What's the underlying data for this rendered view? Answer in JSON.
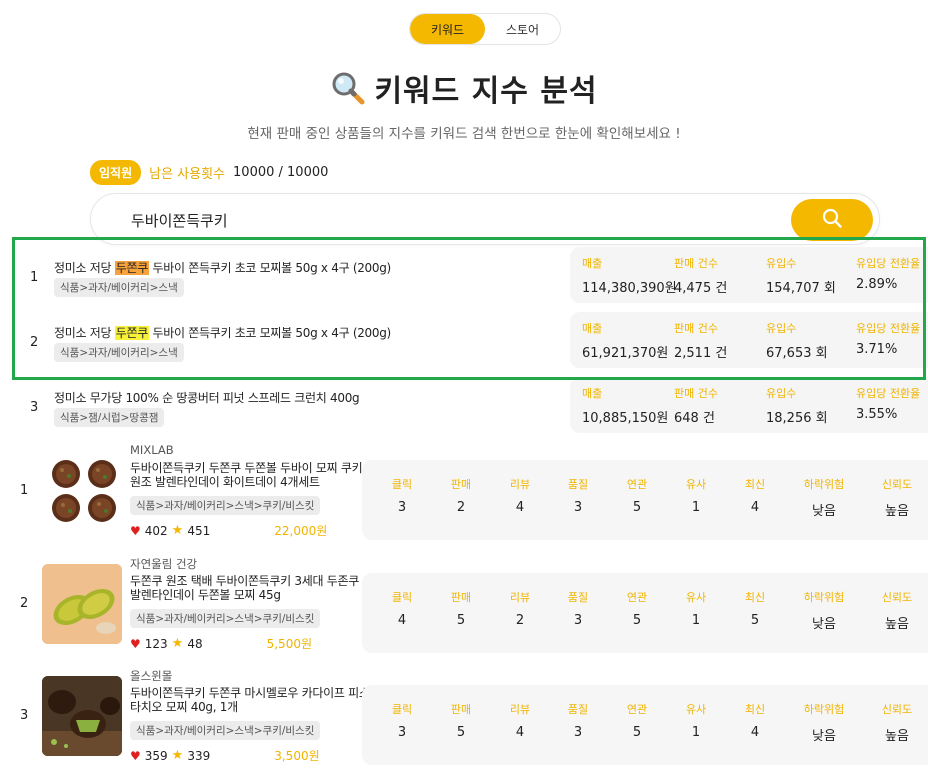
{
  "tabs": [
    {
      "label": "키워드",
      "active": true
    },
    {
      "label": "스토어",
      "active": false
    }
  ],
  "title": "키워드 지수 분석",
  "subtitle": "현재 판매 중인 상품들의 지수를 키워드 검색 한번으로 한눈에 확인해보세요 !",
  "usage": {
    "badge": "임직원",
    "label": "남은 사용횟수",
    "value": "10000 / 10000"
  },
  "search": {
    "value": "두바이쫀득쿠키"
  },
  "colors": {
    "accent": "#f5b800",
    "highlight_orange": "#f7a23a",
    "highlight_yellow": "#f7f13a",
    "selection_box": "#22a84a"
  },
  "keyword_labels": {
    "sales": "매출",
    "count": "판매 건수",
    "inflow": "유입수",
    "conv": "유입당 전환율"
  },
  "keyword_results": [
    {
      "rank": "1",
      "name_pre": "정미소 저당 ",
      "name_hl": "두쫀쿠",
      "name_post": " 두바이 쫀득쿠키 초코 모찌볼 50g x 4구 (200g)",
      "category": "식품>과자/베이커리>스낵",
      "sales": "114,380,390원",
      "count": "4,475 건",
      "inflow": "154,707 회",
      "conv": "2.89%"
    },
    {
      "rank": "2",
      "name_pre": "정미소 저당 ",
      "name_hl": "두쫀쿠",
      "name_post": " 두바이 쫀득쿠키 초코 모찌볼 50g x 4구 (200g)",
      "category": "식품>과자/베이커리>스낵",
      "sales": "61,921,370원",
      "count": "2,511 건",
      "inflow": "67,653 회",
      "conv": "3.71%"
    },
    {
      "rank": "3",
      "name_pre": "정미소 무가당 100% 순 땅콩버터 피넛 스프레드 크런치 400g",
      "name_hl": "",
      "name_post": "",
      "category": "식품>잼/시럽>땅콩잼",
      "sales": "10,885,150원",
      "count": "648 건",
      "inflow": "18,256 회",
      "conv": "3.55%"
    }
  ],
  "product_labels": [
    "클릭",
    "판매",
    "리뷰",
    "품질",
    "연관",
    "유사",
    "최신",
    "하락위험",
    "신뢰도"
  ],
  "products": [
    {
      "rank": "1",
      "store": "MIXLAB",
      "name": "두바이쫀득쿠키 두쫀쿠 두쫀볼 두바이 모찌 쿠키 원조 발렌타인데이 화이트데이 4개세트",
      "category": "식품>과자/베이커리>스낵>쿠키/비스킷",
      "likes": "402",
      "rating": "451",
      "price": "22,000원",
      "scores": [
        "3",
        "2",
        "4",
        "3",
        "5",
        "1",
        "4",
        "낮음",
        "높음"
      ]
    },
    {
      "rank": "2",
      "store": "자연울림 건강",
      "name": "두쫀쿠 원조 택배 두바이쫀득쿠키 3세대 두존쿠 발렌타인데이 두쫀볼 모찌 45g",
      "category": "식품>과자/베이커리>스낵>쿠키/비스킷",
      "likes": "123",
      "rating": "48",
      "price": "5,500원",
      "scores": [
        "4",
        "5",
        "2",
        "3",
        "5",
        "1",
        "5",
        "낮음",
        "높음"
      ]
    },
    {
      "rank": "3",
      "store": "올스윈몰",
      "name": "두바이쫀득쿠키 두쫀쿠 마시멜로우 카다이프 피스타치오 모찌 40g, 1개",
      "category": "식품>과자/베이커리>스낵>쿠키/비스킷",
      "likes": "359",
      "rating": "339",
      "price": "3,500원",
      "scores": [
        "3",
        "5",
        "4",
        "3",
        "5",
        "1",
        "4",
        "낮음",
        "높음"
      ]
    }
  ]
}
